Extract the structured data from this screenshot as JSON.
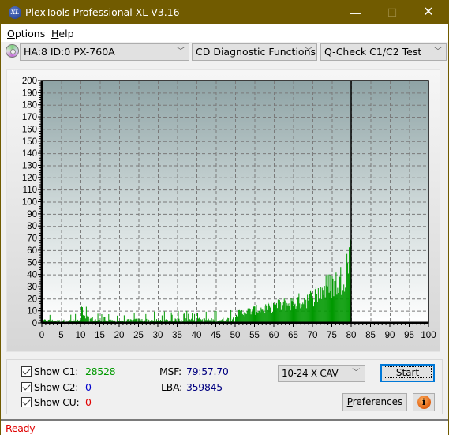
{
  "window": {
    "title": "PlexTools Professional XL V3.16",
    "app_icon_label": "XL",
    "minimize_glyph": "—",
    "maximize_glyph": "☐",
    "close_glyph": "✕"
  },
  "menu": {
    "items": [
      {
        "label_prefix": "O",
        "label_rest": "ptions"
      },
      {
        "label_prefix": "H",
        "label_rest": "elp"
      }
    ]
  },
  "toolbar": {
    "drive": "HA:8 ID:0  PX-760A",
    "function": "CD Diagnostic Functions",
    "test": "Q-Check C1/C2 Test",
    "dropdown_glyph": "﹀"
  },
  "colors": {
    "title_bar": "#715b00",
    "c1": "#009900",
    "c2": "#0000cc",
    "cu": "#e00000",
    "status": "#e00000"
  },
  "stats": {
    "show_c1_label": "Show C1:",
    "show_c2_label": "Show C2:",
    "show_cu_label": "Show CU:",
    "c1_value": "28528",
    "c2_value": "0",
    "cu_value": "0",
    "c1_checked": true,
    "c2_checked": true,
    "cu_checked": true,
    "msf_label": "MSF:",
    "msf_value": "79:57.70",
    "lba_label": "LBA:",
    "lba_value": "359845"
  },
  "controls": {
    "speed": "10-24 X CAV",
    "start_prefix": "S",
    "start_rest": "tart",
    "preferences_prefix": "P",
    "preferences_rest": "references",
    "info_glyph": "i"
  },
  "status": {
    "text": "Ready"
  },
  "chart_data": {
    "type": "bar",
    "title": "",
    "xlabel": "",
    "ylabel": "",
    "xlim": [
      0,
      100
    ],
    "ylim": [
      0,
      200
    ],
    "x_ticks": [
      0,
      5,
      10,
      15,
      20,
      25,
      30,
      35,
      40,
      45,
      50,
      55,
      60,
      65,
      70,
      75,
      80,
      85,
      90,
      95,
      100
    ],
    "y_ticks": [
      0,
      10,
      20,
      30,
      40,
      50,
      60,
      70,
      80,
      90,
      100,
      110,
      120,
      130,
      140,
      150,
      160,
      170,
      180,
      190,
      200
    ],
    "grid": true,
    "end_marker_x": 80,
    "series": [
      {
        "name": "C1",
        "color": "#009900",
        "x_start": 0,
        "x_end": 80,
        "envelope": [
          {
            "x": 0,
            "y": 6
          },
          {
            "x": 5,
            "y": 5
          },
          {
            "x": 10,
            "y": 6
          },
          {
            "x": 10.5,
            "y": 14
          },
          {
            "x": 15,
            "y": 5
          },
          {
            "x": 20,
            "y": 5
          },
          {
            "x": 25,
            "y": 7
          },
          {
            "x": 30,
            "y": 6
          },
          {
            "x": 35,
            "y": 7
          },
          {
            "x": 40,
            "y": 8
          },
          {
            "x": 45,
            "y": 7
          },
          {
            "x": 50,
            "y": 10
          },
          {
            "x": 55,
            "y": 14
          },
          {
            "x": 60,
            "y": 18
          },
          {
            "x": 65,
            "y": 22
          },
          {
            "x": 70,
            "y": 28
          },
          {
            "x": 73,
            "y": 38
          },
          {
            "x": 75,
            "y": 42
          },
          {
            "x": 77,
            "y": 45
          },
          {
            "x": 78,
            "y": 55
          },
          {
            "x": 79,
            "y": 66
          },
          {
            "x": 79.8,
            "y": 74
          }
        ],
        "total": 28528
      },
      {
        "name": "C2",
        "color": "#0000cc",
        "total": 0
      },
      {
        "name": "CU",
        "color": "#e00000",
        "total": 0
      }
    ]
  }
}
